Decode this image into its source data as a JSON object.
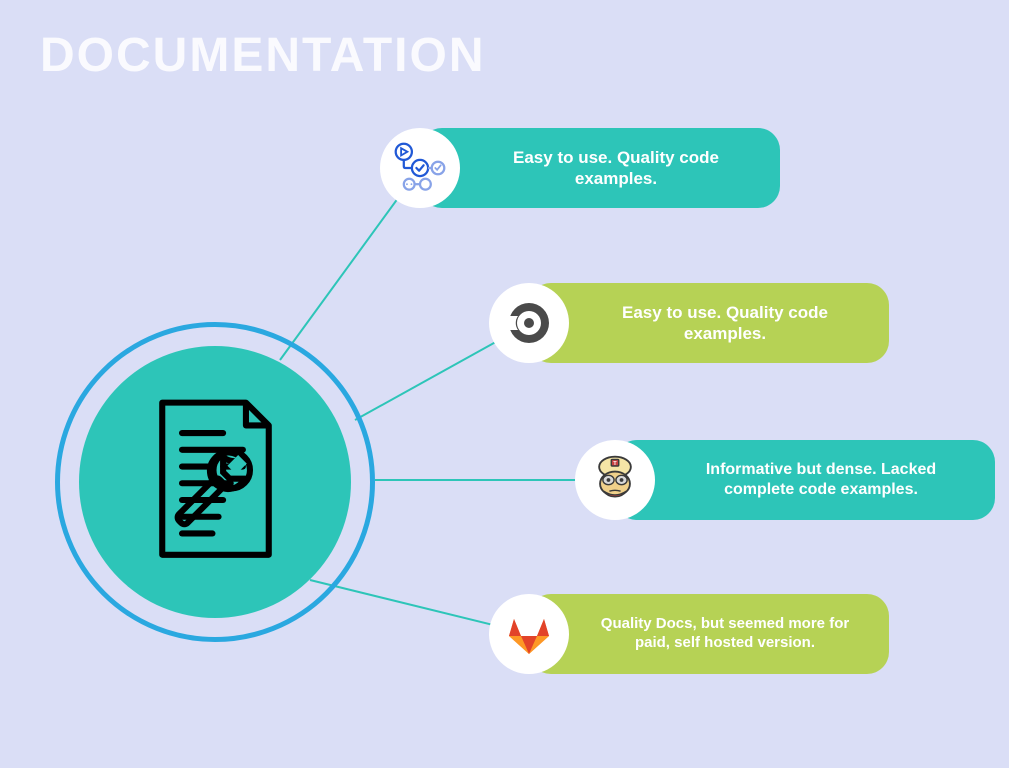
{
  "title": "DOCUMENTATION",
  "hub": {
    "icon": "document-wrench-icon"
  },
  "colors": {
    "teal": "#2dc5b8",
    "lime": "#b6d255",
    "blue": "#2aa8e0",
    "bg": "#dadef6"
  },
  "items": [
    {
      "icon": "github-actions-icon",
      "text": "Easy to use. Quality code examples.",
      "pill_color": "teal"
    },
    {
      "icon": "circleci-icon",
      "text": "Easy to use. Quality code examples.",
      "pill_color": "lime"
    },
    {
      "icon": "travis-ci-icon",
      "text": "Informative but dense. Lacked complete code examples.",
      "pill_color": "teal"
    },
    {
      "icon": "gitlab-icon",
      "text": "Quality Docs, but seemed more for paid, self hosted version.",
      "pill_color": "lime"
    }
  ]
}
